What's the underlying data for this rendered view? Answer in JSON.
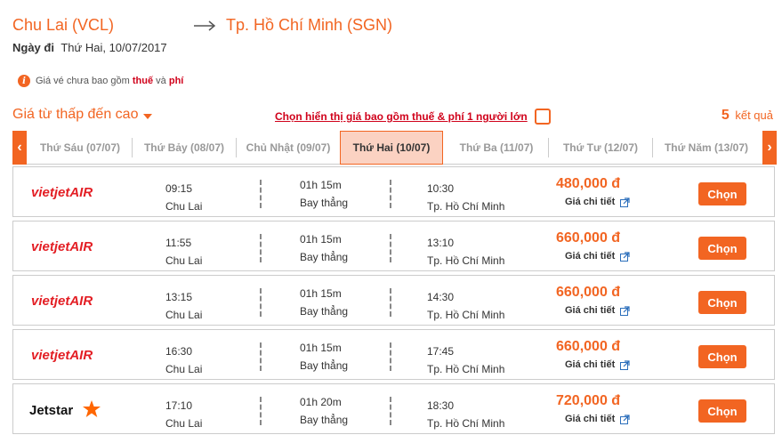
{
  "route": {
    "origin": "Chu Lai (VCL)",
    "destination": "Tp. Hồ Chí Minh (SGN)"
  },
  "depart": {
    "label": "Ngày đi",
    "date": "Thứ Hai, 10/07/2017"
  },
  "notice": {
    "icon": "info-icon",
    "icon_glyph": "i",
    "text_before": "Giá vé chưa bao gồm ",
    "tax": "thuế",
    "and": " và ",
    "fee": "phí"
  },
  "sort": {
    "label": "Giá từ thấp đến cao"
  },
  "include_fee": {
    "label": "Chọn hiển thị giá bao gồm thuế & phí 1 người lớn",
    "checked": false
  },
  "results": {
    "count": "5",
    "label": "kết quả"
  },
  "date_tabs": {
    "prev_glyph": "‹",
    "next_glyph": "›",
    "items": [
      {
        "label": "Thứ Sáu (07/07)",
        "active": false
      },
      {
        "label": "Thứ Bảy (08/07)",
        "active": false
      },
      {
        "label": "Chủ Nhật (09/07)",
        "active": false
      },
      {
        "label": "Thứ Hai (10/07)",
        "active": true
      },
      {
        "label": "Thứ Ba (11/07)",
        "active": false
      },
      {
        "label": "Thứ Tư (12/07)",
        "active": false
      },
      {
        "label": "Thứ Năm (13/07)",
        "active": false
      }
    ]
  },
  "flights": [
    {
      "airline": "VietJet Air",
      "logo": "vietjet-logo",
      "dep_time": "09:15",
      "dep_city": "Chu Lai",
      "duration": "01h 15m",
      "stops": "Bay thẳng",
      "arr_time": "10:30",
      "arr_city": "Tp. Hồ Chí Minh",
      "price": "480,000 đ",
      "detail": "Giá chi tiết",
      "select": "Chọn"
    },
    {
      "airline": "VietJet Air",
      "logo": "vietjet-logo",
      "dep_time": "11:55",
      "dep_city": "Chu Lai",
      "duration": "01h 15m",
      "stops": "Bay thẳng",
      "arr_time": "13:10",
      "arr_city": "Tp. Hồ Chí Minh",
      "price": "660,000 đ",
      "detail": "Giá chi tiết",
      "select": "Chọn"
    },
    {
      "airline": "VietJet Air",
      "logo": "vietjet-logo",
      "dep_time": "13:15",
      "dep_city": "Chu Lai",
      "duration": "01h 15m",
      "stops": "Bay thẳng",
      "arr_time": "14:30",
      "arr_city": "Tp. Hồ Chí Minh",
      "price": "660,000 đ",
      "detail": "Giá chi tiết",
      "select": "Chọn"
    },
    {
      "airline": "VietJet Air",
      "logo": "vietjet-logo",
      "dep_time": "16:30",
      "dep_city": "Chu Lai",
      "duration": "01h 15m",
      "stops": "Bay thẳng",
      "arr_time": "17:45",
      "arr_city": "Tp. Hồ Chí Minh",
      "price": "660,000 đ",
      "detail": "Giá chi tiết",
      "select": "Chọn"
    },
    {
      "airline": "Jetstar",
      "logo": "jetstar-logo",
      "dep_time": "17:10",
      "dep_city": "Chu Lai",
      "duration": "01h 20m",
      "stops": "Bay thẳng",
      "arr_time": "18:30",
      "arr_city": "Tp. Hồ Chí Minh",
      "price": "720,000 đ",
      "detail": "Giá chi tiết",
      "select": "Chọn"
    }
  ],
  "colors": {
    "accent": "#f26522",
    "highlight_red": "#d0021b",
    "active_tab_bg": "#fbd2c2",
    "vietjet_red": "#e31e24",
    "jetstar_orange": "#ff6600",
    "border": "#cccccc"
  }
}
